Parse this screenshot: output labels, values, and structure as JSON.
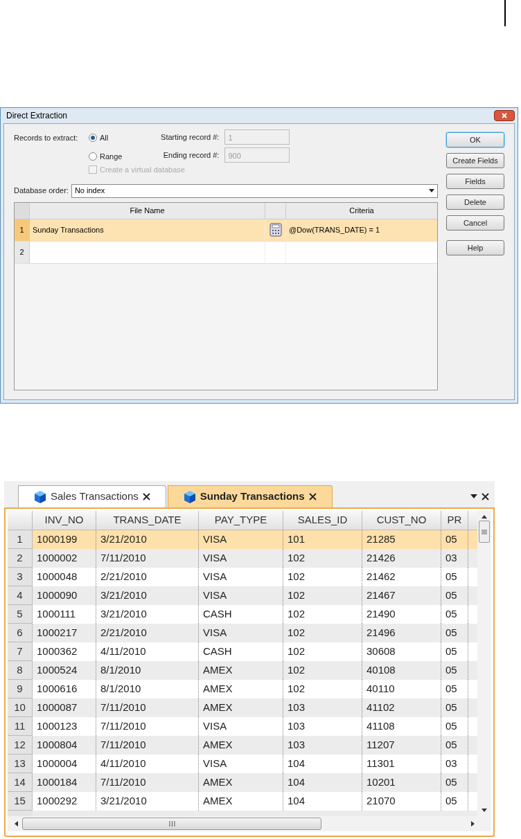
{
  "dialog": {
    "title": "Direct Extraction",
    "records_label": "Records to extract:",
    "radios": [
      {
        "label": "All",
        "selected": true
      },
      {
        "label": "Range",
        "selected": false
      }
    ],
    "starting_label": "Starting record #:",
    "starting_value": "1",
    "ending_label": "Ending record #:",
    "ending_value": "900",
    "virtual_checkbox": {
      "label": "Create a virtual database",
      "checked": false,
      "disabled": true
    },
    "order_label": "Database order:",
    "order_value": "No index",
    "table": {
      "columns": [
        "File Name",
        "Criteria"
      ],
      "rows": [
        {
          "number": "1",
          "file_name": "Sunday Transactions",
          "criteria": "@Dow(TRANS_DATE) = 1",
          "selected": true
        },
        {
          "number": "2",
          "selected": false
        }
      ]
    },
    "buttons": [
      {
        "label": "OK",
        "default": true
      },
      {
        "label": "Create Fields",
        "default": false
      },
      {
        "label": "Fields",
        "default": false
      },
      {
        "label": "Delete",
        "default": false
      },
      {
        "label": "Cancel",
        "default": false
      },
      {
        "label": "Help",
        "default": false
      }
    ]
  },
  "grid": {
    "tabs": [
      {
        "label": "Sales Transactions",
        "selected": false
      },
      {
        "label": "Sunday Transactions",
        "selected": true
      }
    ],
    "columns": [
      "INV_NO",
      "TRANS_DATE",
      "PAY_TYPE",
      "SALES_ID",
      "CUST_NO",
      "PR"
    ],
    "rows": [
      {
        "number": "1",
        "cells": [
          "1000199",
          "3/21/2010",
          "VISA",
          "101",
          "21285",
          "05"
        ],
        "selected": true
      },
      {
        "number": "2",
        "cells": [
          "1000002",
          "7/11/2010",
          "VISA",
          "102",
          "21426",
          "03"
        ],
        "selected": false
      },
      {
        "number": "3",
        "cells": [
          "1000048",
          "2/21/2010",
          "VISA",
          "102",
          "21462",
          "05"
        ],
        "selected": false
      },
      {
        "number": "4",
        "cells": [
          "1000090",
          "3/21/2010",
          "VISA",
          "102",
          "21467",
          "05"
        ],
        "selected": false
      },
      {
        "number": "5",
        "cells": [
          "1000111",
          "3/21/2010",
          "CASH",
          "102",
          "21490",
          "05"
        ],
        "selected": false
      },
      {
        "number": "6",
        "cells": [
          "1000217",
          "2/21/2010",
          "VISA",
          "102",
          "21496",
          "05"
        ],
        "selected": false
      },
      {
        "number": "7",
        "cells": [
          "1000362",
          "4/11/2010",
          "CASH",
          "102",
          "30608",
          "05"
        ],
        "selected": false
      },
      {
        "number": "8",
        "cells": [
          "1000524",
          "8/1/2010",
          "AMEX",
          "102",
          "40108",
          "05"
        ],
        "selected": false
      },
      {
        "number": "9",
        "cells": [
          "1000616",
          "8/1/2010",
          "AMEX",
          "102",
          "40110",
          "05"
        ],
        "selected": false
      },
      {
        "number": "10",
        "cells": [
          "1000087",
          "7/11/2010",
          "AMEX",
          "103",
          "41102",
          "05"
        ],
        "selected": false
      },
      {
        "number": "11",
        "cells": [
          "1000123",
          "7/11/2010",
          "VISA",
          "103",
          "41108",
          "05"
        ],
        "selected": false
      },
      {
        "number": "12",
        "cells": [
          "1000804",
          "7/11/2010",
          "AMEX",
          "103",
          "11207",
          "05"
        ],
        "selected": false
      },
      {
        "number": "13",
        "cells": [
          "1000004",
          "4/11/2010",
          "VISA",
          "104",
          "11301",
          "03"
        ],
        "selected": false
      },
      {
        "number": "14",
        "cells": [
          "1000184",
          "7/11/2010",
          "AMEX",
          "104",
          "10201",
          "05"
        ],
        "selected": false
      },
      {
        "number": "15",
        "cells": [
          "1000292",
          "3/21/2010",
          "AMEX",
          "104",
          "21070",
          "05"
        ],
        "selected": false
      }
    ]
  }
}
